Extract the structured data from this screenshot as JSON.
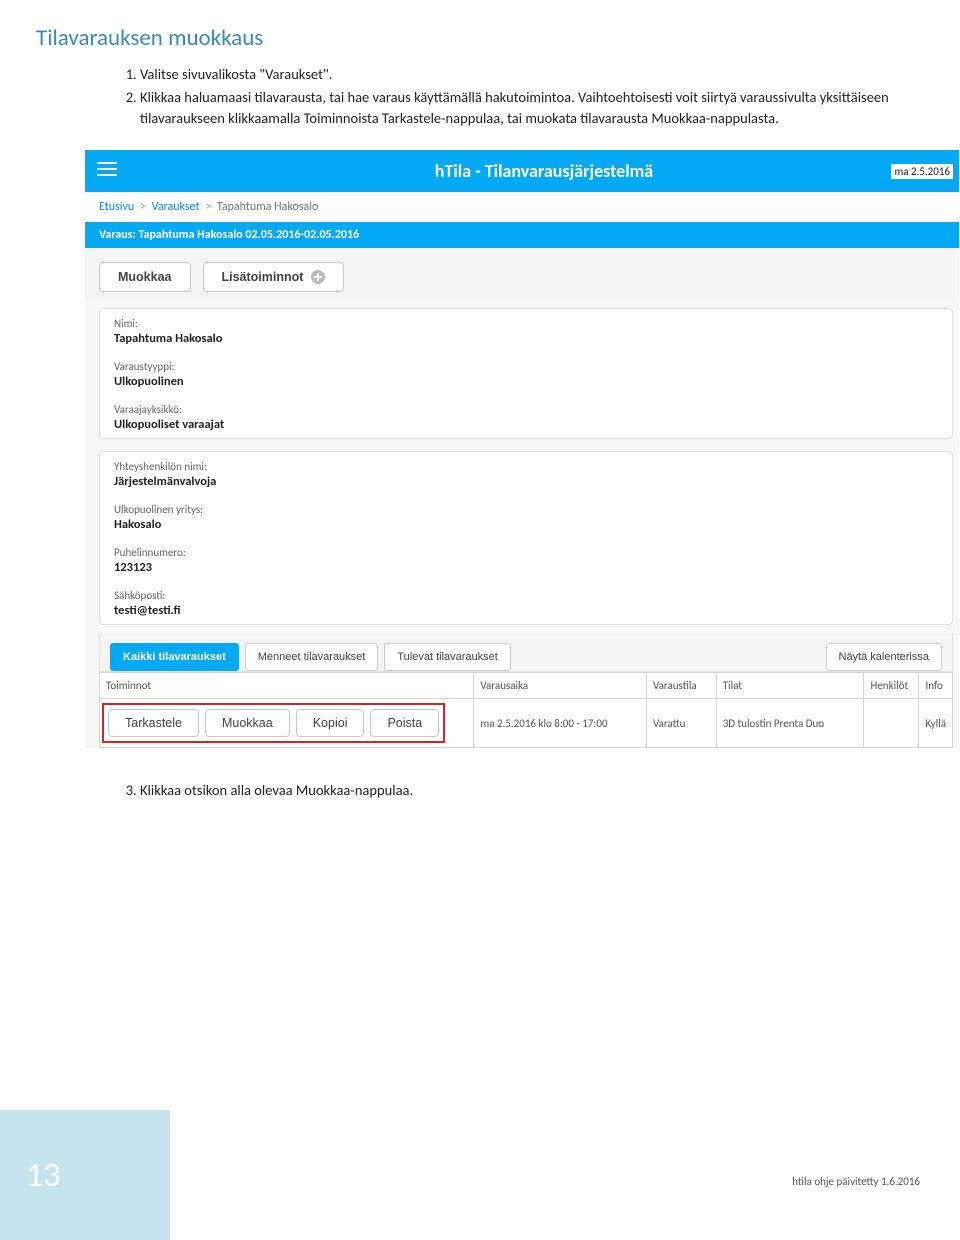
{
  "section_title": "Tilavarauksen muokkaus",
  "steps": {
    "s1": "Valitse sivuvalikosta \"Varaukset\".",
    "s2": "Klikkaa haluamaasi tilavarausta, tai hae varaus käyttämällä hakutoimintoa. Vaihtoehtoisesti voit siirtyä varaussivulta yksittäiseen tilavaraukseen klikkaamalla Toiminnoista Tarkastele-nappulaa, tai muokata tilavarausta Muokkaa-nappulasta.",
    "s3": "Klikkaa otsikon alla olevaa Muokkaa-nappulaa."
  },
  "app": {
    "title": "hTila - Tilanvarausjärjestelmä",
    "date": "ma 2.5.2016"
  },
  "breadcrumb": {
    "a": "Etusivu",
    "b": "Varaukset",
    "c": "Tapahtuma Hakosalo"
  },
  "varaus_bar": "Varaus: Tapahtuma Hakosalo 02.05.2016-02.05.2016",
  "actions": {
    "muokkaa": "Muokkaa",
    "lisatoiminnot": "Lisätoiminnot"
  },
  "card1": {
    "nimi_lbl": "Nimi:",
    "nimi_val": "Tapahtuma Hakosalo",
    "tyyppi_lbl": "Varaustyyppi:",
    "tyyppi_val": "Ulkopuolinen",
    "yksikko_lbl": "Varaajayksikkö:",
    "yksikko_val": "Ulkopuoliset varaajat"
  },
  "card2": {
    "yht_lbl": "Yhteyshenkilön nimi:",
    "yht_val": "Järjestelmänvalvoja",
    "yritys_lbl": "Ulkopuolinen yritys:",
    "yritys_val": "Hakosalo",
    "puh_lbl": "Puhelinnumero:",
    "puh_val": "123123",
    "email_lbl": "Sähköposti:",
    "email_val": "testi@testi.fi"
  },
  "tabs": {
    "t1": "Kaikki tilavaraukset",
    "t2": "Menneet tilavaraukset",
    "t3": "Tulevat tilavaraukset",
    "cal": "Näytä kalenterissa"
  },
  "table": {
    "h_toiminnot": "Toiminnot",
    "h_aika": "Varausaika",
    "h_tila": "Varaustila",
    "h_tilat": "Tilat",
    "h_henkilot": "Henkilöt",
    "h_info": "Info",
    "r1_aika": "ma 2.5.2016 klo 8:00 - 17:00",
    "r1_tila": "Varattu",
    "r1_tilat": "3D tulostin Prenta Duo",
    "r1_henkilot": "",
    "r1_info": "Kyllä",
    "tools": {
      "tarkastele": "Tarkastele",
      "muokkaa": "Muokkaa",
      "kopioi": "Kopioi",
      "poista": "Poista"
    }
  },
  "page_number": "13",
  "footer": "htila ohje päivitetty 1.6.2016"
}
